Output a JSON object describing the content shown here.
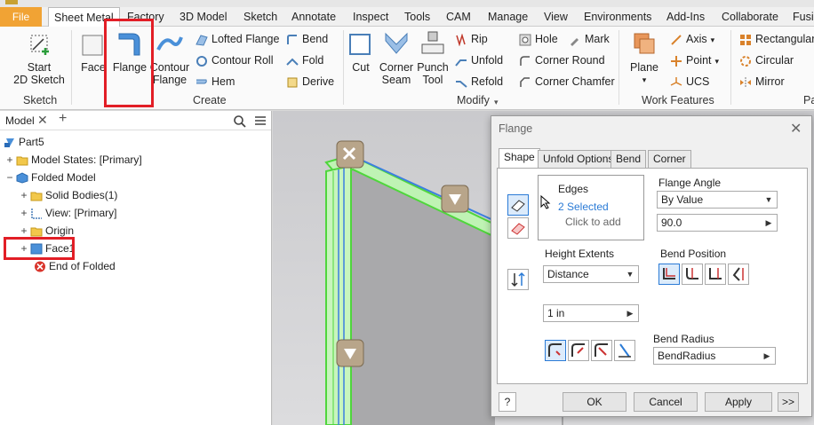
{
  "ribbon_tabs": {
    "file": "File",
    "items": [
      "Sheet Metal",
      "Factory",
      "3D Model",
      "Sketch",
      "Annotate",
      "Inspect",
      "Tools",
      "CAM",
      "Manage",
      "View",
      "Environments",
      "Add-Ins",
      "Collaborate",
      "Fusi"
    ]
  },
  "ribbon": {
    "sketch": {
      "start": "Start",
      "sketch2d": "2D Sketch",
      "title": "Sketch"
    },
    "create": {
      "title": "Create",
      "face": "Face",
      "flange": "Flange",
      "contour_flange_1": "Contour",
      "contour_flange_2": "Flange",
      "lofted_flange": "Lofted Flange",
      "contour_roll": "Contour Roll",
      "hem": "Hem",
      "bend": "Bend",
      "fold": "Fold",
      "derive": "Derive"
    },
    "modify": {
      "title": "Modify",
      "cut": "Cut",
      "corner_seam_1": "Corner",
      "corner_seam_2": "Seam",
      "punch_tool_1": "Punch",
      "punch_tool_2": "Tool",
      "rip": "Rip",
      "unfold": "Unfold",
      "refold": "Refold",
      "hole": "Hole",
      "mark": "Mark",
      "corner_round": "Corner Round",
      "corner_chamfer": "Corner Chamfer"
    },
    "work_features": {
      "title": "Work Features",
      "plane": "Plane",
      "axis": "Axis",
      "point": "Point",
      "ucs": "UCS"
    },
    "pattern": {
      "title": "Pa",
      "rectangular": "Rectangular",
      "circular": "Circular",
      "mirror": "Mirror"
    }
  },
  "browser": {
    "tab": "Model",
    "add": "+",
    "items": [
      "Part5",
      "Model States: [Primary]",
      "Folded Model",
      "Solid Bodies(1)",
      "View: [Primary]",
      "Origin",
      "Face1",
      "End of Folded"
    ]
  },
  "dialog": {
    "title": "Flange",
    "tabs": [
      "Shape",
      "Unfold Options",
      "Bend",
      "Corner"
    ],
    "edges_label": "Edges",
    "edges_selected": "2 Selected",
    "edges_hint": "Click to add",
    "flange_angle_label": "Flange Angle",
    "flange_angle_mode": "By Value",
    "flange_angle_value": "90.0",
    "height_extents_label": "Height Extents",
    "height_extents_mode": "Distance",
    "height_value": "1 in",
    "bend_position_label": "Bend Position",
    "bend_radius_label": "Bend Radius",
    "bend_radius_value": "BendRadius",
    "help": "?",
    "ok": "OK",
    "cancel": "Cancel",
    "apply": "Apply",
    "more": ">>"
  },
  "colors": {
    "accent": "#2b7bd6",
    "file_tab": "#f1a334",
    "highlight": "#e21e26",
    "flange_green": "#5fdc4c"
  }
}
